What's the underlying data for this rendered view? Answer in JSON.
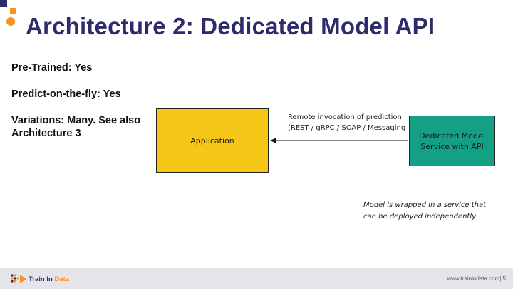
{
  "slide": {
    "title": "Architecture 2: Dedicated Model API",
    "bullets": [
      "Pre-Trained: Yes",
      "Predict-on-the-fly: Yes",
      "Variations: Many. See also Architecture 3"
    ]
  },
  "diagram": {
    "application_label": "Application",
    "service_label": "Dedicated Model Service with API",
    "arrow_label_line1": "Remote invocation of prediction",
    "arrow_label_line2": "(REST / gRPC / SOAP / Messaging",
    "note_line1": "Model is wrapped in a service that",
    "note_line2": "can be deployed independently"
  },
  "footer": {
    "logo_text_main": "Train In ",
    "logo_text_accent": "Data",
    "right_text": "www.trainindata.com| 5"
  },
  "colors": {
    "title": "#2d2b6b",
    "accent": "#f7941d",
    "application_fill": "#f5c518",
    "service_fill": "#14a085",
    "footer_bg": "#e4e4ea"
  }
}
